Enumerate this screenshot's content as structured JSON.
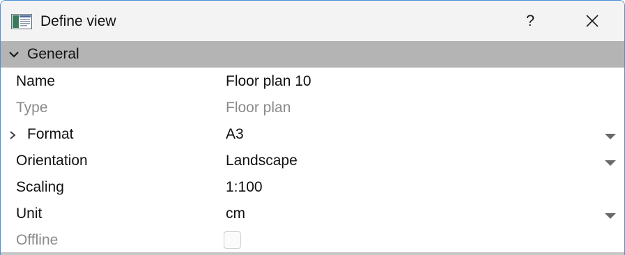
{
  "window": {
    "title": "Define view",
    "help_label": "?",
    "icons": {
      "app": "view-window-icon",
      "close": "close-icon"
    }
  },
  "section": {
    "label": "General",
    "expanded": true,
    "icon": "chevron-down-icon"
  },
  "properties": [
    {
      "label": "Name",
      "value": "Floor plan 10",
      "enabled": true,
      "control": "text"
    },
    {
      "label": "Type",
      "value": "Floor plan",
      "enabled": false,
      "control": "text"
    },
    {
      "label": "Format",
      "value": "A3",
      "enabled": true,
      "control": "dropdown",
      "expandable": true
    },
    {
      "label": "Orientation",
      "value": "Landscape",
      "enabled": true,
      "control": "dropdown"
    },
    {
      "label": "Scaling",
      "value": "1:100",
      "enabled": true,
      "control": "text"
    },
    {
      "label": "Unit",
      "value": "cm",
      "enabled": true,
      "control": "dropdown"
    },
    {
      "label": "Offline",
      "value_checked": false,
      "enabled": false,
      "control": "checkbox"
    }
  ],
  "colors": {
    "window_border": "#4a90d9",
    "titlebar_bg": "#f3f3f3",
    "section_header_bg": "#b4b4b4",
    "disabled_text": "#8a8a8a"
  }
}
